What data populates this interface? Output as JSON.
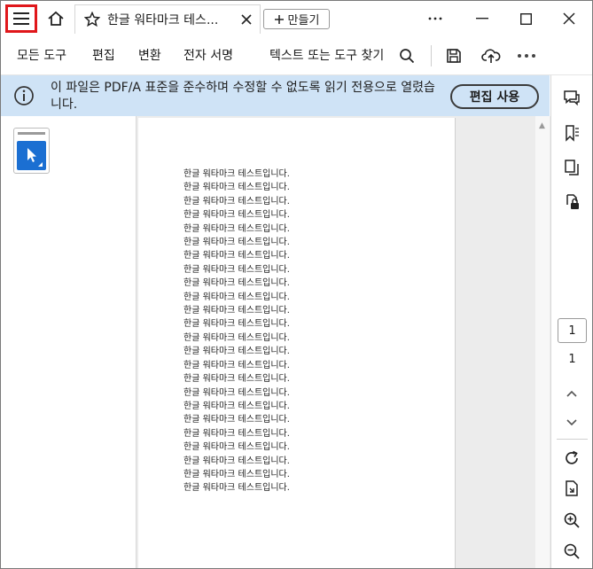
{
  "tab": {
    "title": "한글 워타마크 테스..."
  },
  "new_button_label": "만들기",
  "toolbar": {
    "all_tools": "모든 도구",
    "edit": "편집",
    "convert": "변환",
    "e_sign": "전자 서명",
    "search_placeholder": "텍스트 또는 도구 찾기"
  },
  "banner": {
    "message": "이 파일은 PDF/A 표준을 준수하며 수정할 수 없도록 읽기 전용으로 열렸습니다.",
    "edit_button": "편집 사용"
  },
  "document": {
    "lines": [
      "한글 워타마크 테스트입니다.",
      "한글 워타마크 테스트입니다.",
      "한글 워타마크 테스트입니다.",
      "한글 워타마크 테스트입니다.",
      "한글 워타마크 테스트입니다.",
      "한글 워타마크 테스트입니다.",
      "한글 워타마크 테스트입니다.",
      "한글 워타마크 테스트입니다.",
      "한글 워타마크 테스트입니다.",
      "한글 워타마크 테스트입니다.",
      "한글 워타마크 테스트입니다.",
      "한글 워타마크 테스트입니다.",
      "한글 워타마크 테스트입니다.",
      "한글 워타마크 테스트입니다.",
      "한글 워타마크 테스트입니다.",
      "한글 워타마크 테스트입니다.",
      "한글 워타마크 테스트입니다.",
      "한글 워타마크 테스트입니다.",
      "한글 워타마크 테스트입니다.",
      "한글 워타마크 테스트입니다.",
      "한글 워타마크 테스트입니다.",
      "한글 워타마크 테스트입니다.",
      "한글 워타마크 테스트입니다.",
      "한글 워타마크 테스트입니다."
    ]
  },
  "pager": {
    "current": "1",
    "total": "1"
  },
  "icons": {
    "menu": "hamburger-icon",
    "home": "home-icon",
    "star": "star-icon",
    "close_tab": "close-icon",
    "plus": "plus-icon",
    "more": "more-icon",
    "minimize": "minimize-icon",
    "maximize": "maximize-icon",
    "close_window": "close-icon",
    "search": "search-icon",
    "save": "save-icon",
    "upload": "cloud-upload-icon",
    "info": "info-icon",
    "comment": "comment-icon",
    "bookmark": "bookmark-icon",
    "copy": "copy-icon",
    "lock": "lock-icon",
    "chevron_up": "chevron-up-icon",
    "chevron_down": "chevron-down-icon",
    "rotate": "rotate-icon",
    "extract": "extract-icon",
    "zoom_in": "zoom-in-icon",
    "zoom_out": "zoom-out-icon"
  },
  "colors": {
    "banner_bg": "#cfe3f6",
    "highlight": "#e0171b",
    "accent_blue": "#1b6fd2"
  }
}
